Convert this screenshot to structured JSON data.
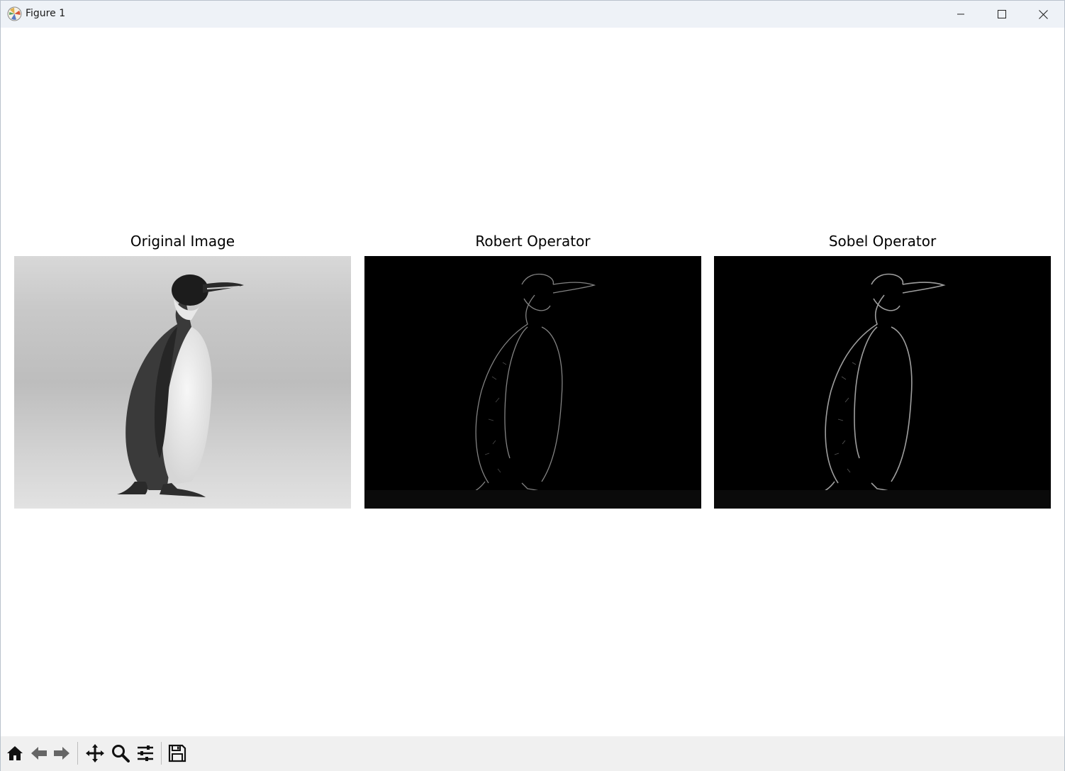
{
  "window": {
    "title": "Figure 1",
    "controls": {
      "minimize": "minimize-icon",
      "maximize": "maximize-icon",
      "close": "close-icon"
    }
  },
  "figure": {
    "subplots": [
      {
        "title": "Original Image",
        "image": "grayscale photo of a king penguin standing on sand"
      },
      {
        "title": "Robert Operator",
        "image": "edge map of the penguin on black background"
      },
      {
        "title": "Sobel Operator",
        "image": "edge map of the penguin on black background"
      }
    ]
  },
  "toolbar": {
    "tools": [
      "home-icon",
      "back-icon",
      "forward-icon",
      "pan-icon",
      "zoom-icon",
      "configure-subplots-icon",
      "save-icon"
    ]
  },
  "colors": {
    "titlebar_bg": "#eef2f7",
    "toolbar_bg": "#f0f0f0",
    "figure_bg": "#ffffff",
    "edge_bg": "#000000"
  }
}
